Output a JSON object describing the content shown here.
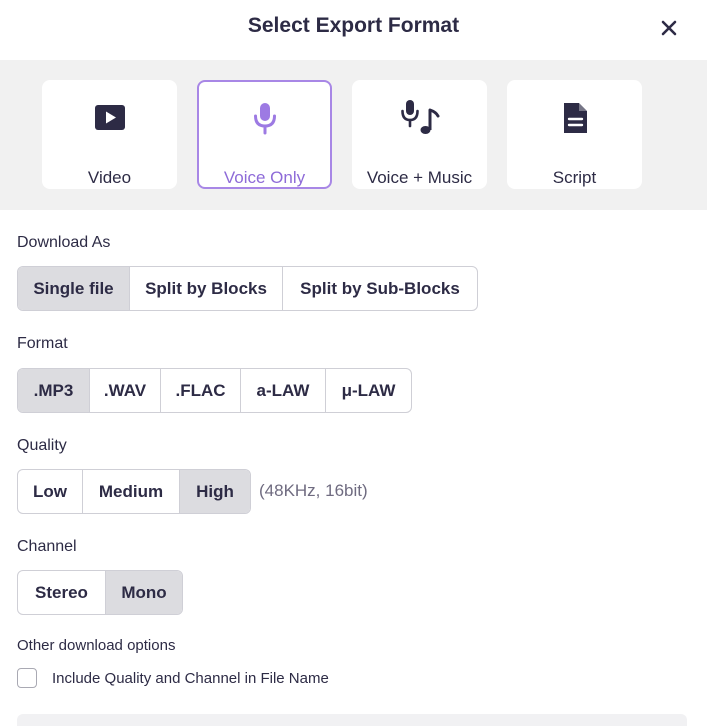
{
  "dialog": {
    "title": "Select Export Format",
    "close_icon": "close-icon"
  },
  "formats": [
    {
      "label": "Video",
      "icon": "video-play-icon",
      "selected": false
    },
    {
      "label": "Voice Only",
      "icon": "microphone-icon",
      "selected": true
    },
    {
      "label": "Voice + Music",
      "icon": "microphone-music-note-icon",
      "selected": false
    },
    {
      "label": "Script",
      "icon": "document-icon",
      "selected": false
    }
  ],
  "download_as": {
    "label": "Download As",
    "options": [
      "Single file",
      "Split by Blocks",
      "Split by Sub-Blocks"
    ],
    "selected": "Single file"
  },
  "format": {
    "label": "Format",
    "options": [
      ".MP3",
      ".WAV",
      ".FLAC",
      "a-LAW",
      "μ-LAW"
    ],
    "selected": ".MP3"
  },
  "quality": {
    "label": "Quality",
    "options": [
      "Low",
      "Medium",
      "High"
    ],
    "selected": "High",
    "note": "(48KHz, 16bit)"
  },
  "channel": {
    "label": "Channel",
    "options": [
      "Stereo",
      "Mono"
    ],
    "selected": "Mono"
  },
  "other": {
    "label": "Other download options",
    "checkbox_label": "Include Quality and Channel in File Name",
    "checked": false
  },
  "colors": {
    "accent": "#a887e6",
    "accent_text": "#8e6bd8",
    "selected_option_bg": "#dcdce0",
    "band_bg": "#f1f1f1",
    "text": "#2d2b45"
  }
}
